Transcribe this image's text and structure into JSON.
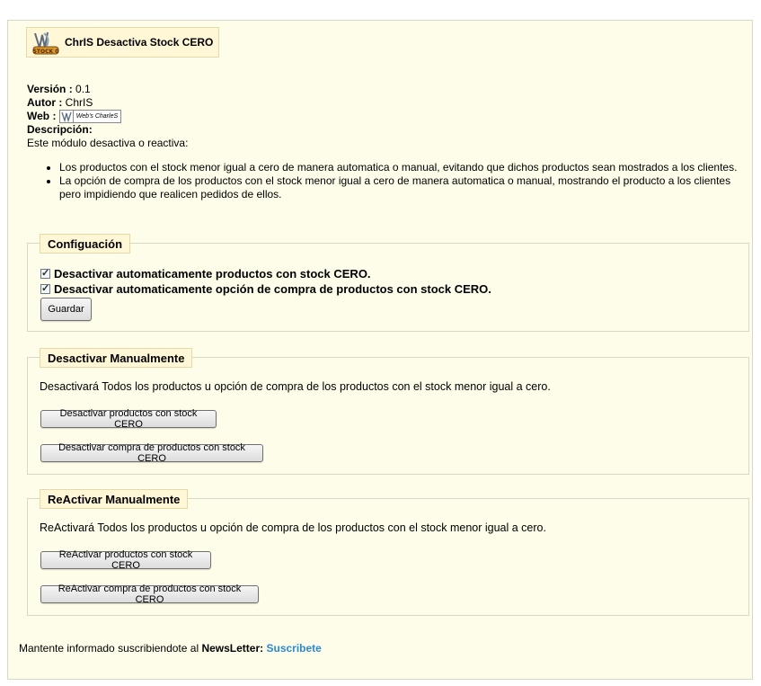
{
  "module": {
    "title": "ChrIS Desactiva Stock CERO",
    "logo_label": "STOCK 0"
  },
  "info": {
    "version_label": "Versión :",
    "version_value": "0.1",
    "author_label": "Autor :",
    "author_value": "ChrIS",
    "web_label": "Web :",
    "web_badge_text": "Web's CharleS",
    "description_label": "Descripción:",
    "description_intro": "Este módulo desactiva o reactiva:",
    "bullets": [
      "Los productos con el stock menor igual a cero de manera automatica o manual, evitando que dichos productos sean mostrados a los clientes.",
      "La opción de compra de los productos con el stock menor igual a cero de manera automatica o manual, mostrando el producto a los clientes pero impidiendo que realicen pedidos de ellos."
    ]
  },
  "config": {
    "legend": "Configuación",
    "checkbox1_label": "Desactivar automaticamente productos con stock CERO.",
    "checkbox2_label": "Desactivar automaticamente opción de compra de productos con stock CERO.",
    "checkbox1_checked": true,
    "checkbox2_checked": true,
    "save_label": "Guardar"
  },
  "deactivate": {
    "legend": "Desactivar Manualmente",
    "text": "Desactivará Todos los productos u opción de compra de los productos con el stock menor igual a cero.",
    "button1": "Desactivar productos con stock CERO",
    "button2": "Desactivar compra de productos con stock CERO"
  },
  "reactivate": {
    "legend": "ReActivar Manualmente",
    "text": "ReActivará Todos los productos u opción de compra de los productos con el stock menor igual a cero.",
    "button1": "ReActivar productos con stock CERO",
    "button2": "ReActivar compra de productos con stock CERO"
  },
  "footer": {
    "text": "Mantente informado suscribiendote al ",
    "newsletter": "NewsLetter:",
    "link": "Suscribete"
  }
}
